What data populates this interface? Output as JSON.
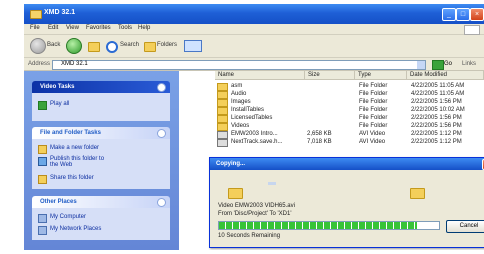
{
  "window": {
    "title": "XMD 32.1",
    "menu": [
      "File",
      "Edit",
      "View",
      "Favorites",
      "Tools",
      "Help"
    ],
    "controls": {
      "minimize": "_",
      "maximize": "□",
      "close": "×"
    }
  },
  "toolbar": {
    "back": "Back",
    "search": "Search",
    "folders": "Folders"
  },
  "address": {
    "label": "Address",
    "value": "XMD 32.1",
    "go": "Go",
    "links": "Links"
  },
  "taskpane": {
    "video_tasks": {
      "title": "Video Tasks",
      "items": [
        "Play all"
      ]
    },
    "file_folder_tasks": {
      "title": "File and Folder Tasks",
      "items": [
        "Make a new folder",
        "Publish this folder to the Web",
        "Share this folder"
      ]
    },
    "other_places": {
      "title": "Other Places",
      "items": [
        "My Computer",
        "My Network Places"
      ]
    }
  },
  "filelist": {
    "columns": [
      "Name",
      "Size",
      "Type",
      "Date Modified"
    ],
    "rows": [
      {
        "name": "asm",
        "size": "",
        "type": "File Folder",
        "date": "4/22/2005 11:05 AM",
        "kind": "folder"
      },
      {
        "name": "Audio",
        "size": "",
        "type": "File Folder",
        "date": "4/22/2005 11:05 AM",
        "kind": "folder"
      },
      {
        "name": "Images",
        "size": "",
        "type": "File Folder",
        "date": "2/22/2005 1:56 PM",
        "kind": "folder"
      },
      {
        "name": "InstallTables",
        "size": "",
        "type": "File Folder",
        "date": "2/22/2005 10:02 AM",
        "kind": "folder"
      },
      {
        "name": "LicensedTables",
        "size": "",
        "type": "File Folder",
        "date": "2/22/2005 1:56 PM",
        "kind": "folder"
      },
      {
        "name": "Videos",
        "size": "",
        "type": "File Folder",
        "date": "2/22/2005 1:56 PM",
        "kind": "folder"
      },
      {
        "name": "EMW2003 Intro...",
        "size": "2,658 KB",
        "type": "AVI Video",
        "date": "2/22/2005 1:12 PM",
        "kind": "file"
      },
      {
        "name": "NextTrack.save.h...",
        "size": "7,018 KB",
        "type": "AVI Video",
        "date": "2/22/2005 1:12 PM",
        "kind": "file"
      }
    ]
  },
  "dialog": {
    "title": "Copying...",
    "close": "×",
    "file_line": "Video EMW2003 VIDH65.avi",
    "from_line": "From 'Disc/Project' To 'XD1'",
    "time_left": "10 Seconds Remaining",
    "cancel": "Cancel",
    "progress": 0.9
  }
}
